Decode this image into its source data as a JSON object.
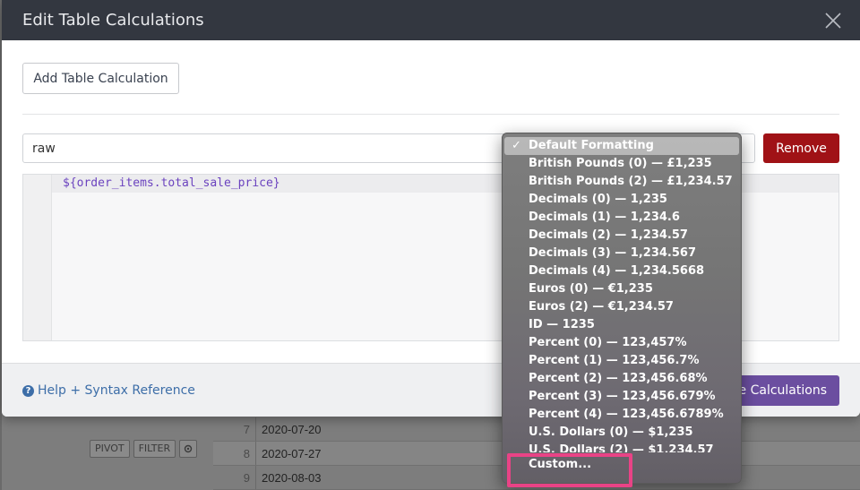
{
  "modal": {
    "title": "Edit Table Calculations",
    "add_button": "Add Table Calculation",
    "name_value": "raw",
    "remove_button": "Remove",
    "expression": "${order_items.total_sale_price}",
    "help_link": "Help + Syntax Reference",
    "save_button": "e Calculations",
    "help_icon_glyph": "?"
  },
  "format_menu": {
    "selected_check": "✓",
    "items": [
      "Default Formatting",
      "British Pounds (0) — £1,235",
      "British Pounds (2) — £1,234.57",
      "Decimals (0) — 1,235",
      "Decimals (1) — 1,234.6",
      "Decimals (2) — 1,234.57",
      "Decimals (3) — 1,234.567",
      "Decimals (4) — 1,234.5668",
      "Euros (0) — €1,235",
      "Euros (2) — €1,234.57",
      "ID — 1235",
      "Percent (0) — 123,457%",
      "Percent (1) — 123,456.7%",
      "Percent (2) — 123,456.68%",
      "Percent (3) — 123,456.679%",
      "Percent (4) — 123,456.6789%",
      "U.S. Dollars (0) — $1,235",
      "U.S. Dollars (2) — $1,234.57",
      "Custom..."
    ],
    "highlight_color": "#e94386"
  },
  "background": {
    "toolbar": {
      "pivot": "PIVOT",
      "filter": "FILTER"
    },
    "rows": [
      {
        "num": "7",
        "date": "2020-07-20"
      },
      {
        "num": "8",
        "date": "2020-07-27"
      },
      {
        "num": "9",
        "date": "2020-08-03"
      }
    ]
  },
  "colors": {
    "header_bg": "#333740",
    "remove_bg": "#a01216",
    "save_bg": "#6b4ea0",
    "expression_color": "#6b43bf",
    "link_color": "#3d6ea8"
  }
}
